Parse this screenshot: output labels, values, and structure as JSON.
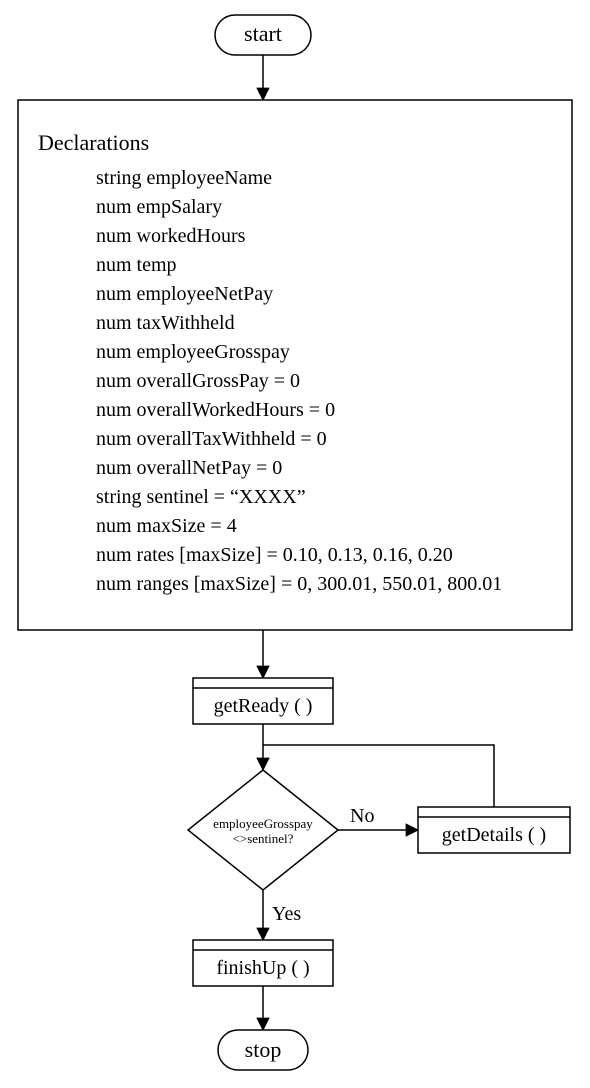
{
  "chart_data": {
    "type": "flowchart",
    "nodes": [
      {
        "id": "start",
        "kind": "terminator",
        "label": "start"
      },
      {
        "id": "decl",
        "kind": "process",
        "title": "Declarations",
        "lines": [
          "string employeeName",
          "num empSalary",
          "num workedHours",
          "num temp",
          "num employeeNetPay",
          "num taxWithheld",
          "num employeeGrosspay",
          "num overallGrossPay = 0",
          "num overallWorkedHours = 0",
          "num overallTaxWithheld = 0",
          "num overallNetPay = 0",
          "string sentinel = “XXXX”",
          "num maxSize = 4",
          "num rates [maxSize] = 0.10, 0.13, 0.16, 0.20",
          "num ranges [maxSize] = 0, 300.01, 550.01, 800.01"
        ]
      },
      {
        "id": "getReady",
        "kind": "subroutine",
        "label": "getReady ( )"
      },
      {
        "id": "decision",
        "kind": "decision",
        "line1": "employeeGrosspay",
        "line2": "<>sentinel?"
      },
      {
        "id": "getDetails",
        "kind": "subroutine",
        "label": "getDetails ( )"
      },
      {
        "id": "finishUp",
        "kind": "subroutine",
        "label": "finishUp ( )"
      },
      {
        "id": "stop",
        "kind": "terminator",
        "label": "stop"
      }
    ],
    "edges": [
      {
        "from": "start",
        "to": "decl"
      },
      {
        "from": "decl",
        "to": "getReady"
      },
      {
        "from": "getReady",
        "to": "decision"
      },
      {
        "from": "decision",
        "to": "getDetails",
        "label": "No"
      },
      {
        "from": "getDetails",
        "to": "decision"
      },
      {
        "from": "decision",
        "to": "finishUp",
        "label": "Yes"
      },
      {
        "from": "finishUp",
        "to": "stop"
      }
    ]
  }
}
